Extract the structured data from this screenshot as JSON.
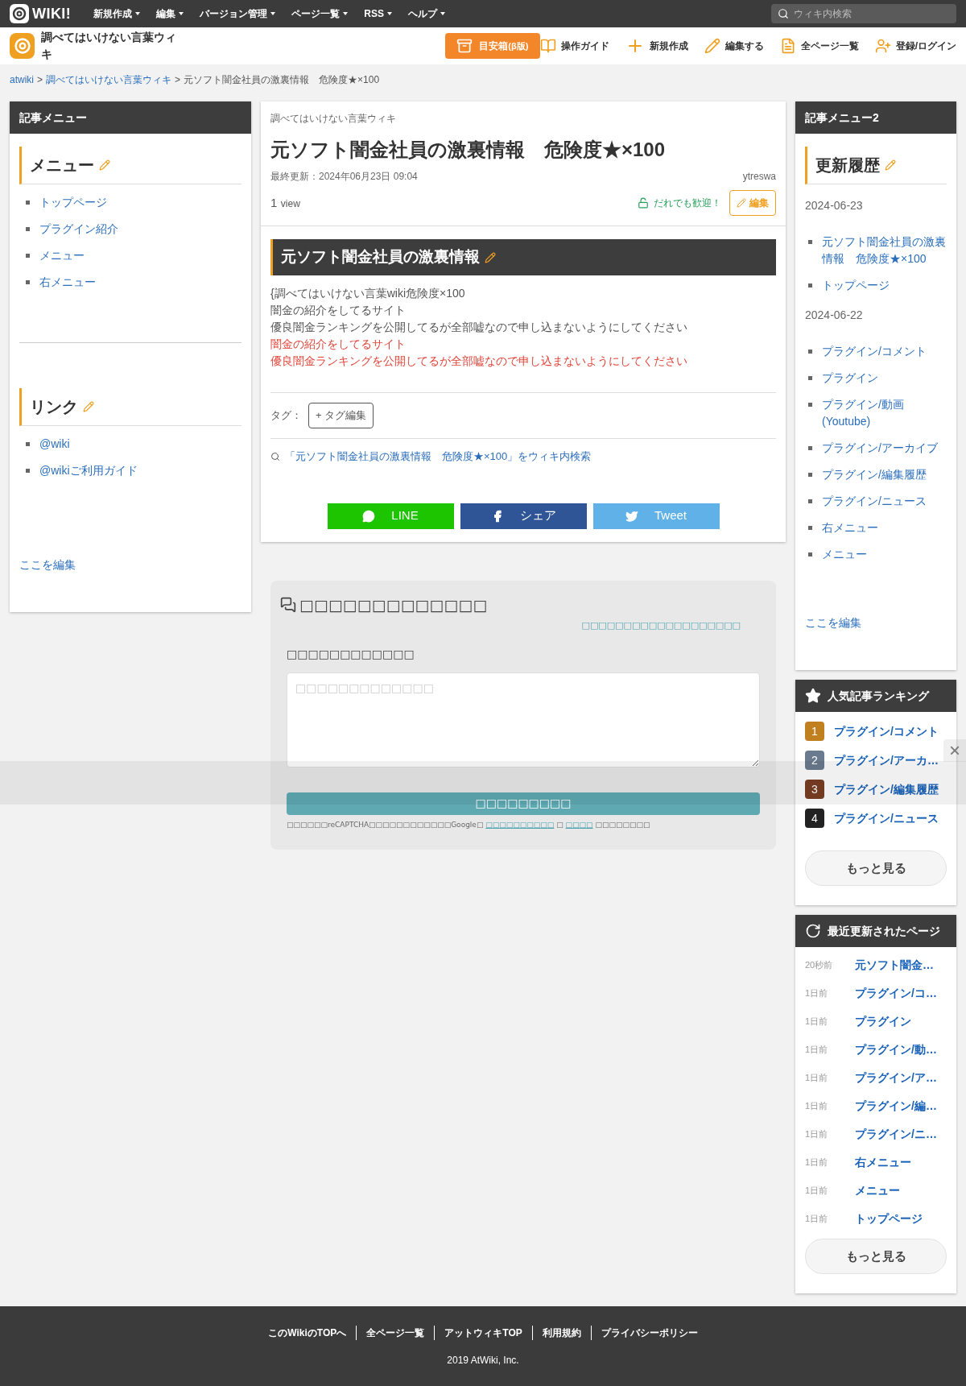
{
  "topbar": {
    "logo": "WIKI!",
    "menus": [
      {
        "label": "新規作成"
      },
      {
        "label": "編集"
      },
      {
        "label": "バージョン管理"
      },
      {
        "label": "ページ一覧"
      },
      {
        "label": "RSS"
      },
      {
        "label": "ヘルプ"
      }
    ],
    "search": {
      "placeholder": "ウィキ内検索"
    }
  },
  "subbar": {
    "site_title": "調べてはいけない言葉ウィキ",
    "box_button": {
      "label": "目安箱",
      "suffix": "(β版)"
    },
    "actions": [
      {
        "kind": "guide",
        "label": "操作ガイド"
      },
      {
        "kind": "new",
        "label": "新規作成"
      },
      {
        "kind": "edit",
        "label": "編集する"
      },
      {
        "kind": "list",
        "label": "全ページ一覧"
      },
      {
        "kind": "login",
        "label": "登録/ログイン"
      }
    ]
  },
  "breadcrumb": [
    {
      "label": "atwiki",
      "link": true
    },
    {
      "label": ">",
      "link": false
    },
    {
      "label": "調べてはいけない言葉ウィキ",
      "link": true
    },
    {
      "label": ">",
      "link": false
    },
    {
      "label": "元ソフト闇金社員の激裏情報　危険度★×100",
      "link": false
    }
  ],
  "left_sidebar": {
    "title": "記事メニュー",
    "sections": [
      {
        "heading": "メニュー",
        "items": [
          "トップページ",
          "プラグイン紹介",
          "メニュー",
          "右メニュー"
        ]
      },
      {
        "heading": "リンク",
        "items": [
          "@wiki",
          "@wikiご利用ガイド"
        ]
      }
    ],
    "edit_link": "ここを編集"
  },
  "article": {
    "site": "調べてはいけない言葉ウィキ",
    "title": "元ソフト闇金社員の激裏情報　危険度★×100",
    "updated": "最終更新：2024年06月23日 09:04",
    "author": "ytreswa",
    "views": "1",
    "views_unit": "view",
    "welcome": "だれでも歓迎！",
    "edit_button": "編集",
    "section_heading": "元ソフト闇金社員の激裏情報",
    "lines": [
      {
        "text": "{調べてはいけない言葉wiki危険度×100",
        "color": "#555555"
      },
      {
        "text": "闇金の紹介をしてるサイト",
        "color": "#555555"
      },
      {
        "text": "優良闇金ランキングを公開してるが全部嘘なので申し込まないようにしてください",
        "color": "#555555"
      },
      {
        "text": "闇金の紹介をしてるサイト",
        "color": "#e0453a"
      },
      {
        "text": "優良闇金ランキングを公開してるが全部嘘なので申し込まないようにしてください",
        "color": "#e0453a"
      }
    ],
    "tags_label": "タグ：",
    "tag_edit_button": "+ タグ編集",
    "search_link": "「元ソフト闇金社員の激裏情報　危険度★×100」をウィキ内検索",
    "share": [
      {
        "kind": "line",
        "label": "LINE"
      },
      {
        "kind": "facebook",
        "label": "シェア"
      },
      {
        "kind": "twitter",
        "label": "Tweet"
      }
    ]
  },
  "comment_box": {
    "heading": "□□□□□□□□□□□□□",
    "top_link": "□□□□□□□□□□□□□□□□□□□",
    "label": "□□□□□□□□□□□□",
    "placeholder": "□□□□□□□□□□□□□",
    "submit": "□□□□□□□□□",
    "notice_start": "□□□□□□reCAPTCHA□□□□□□□□□□□□Google□",
    "notice_link1": "□□□□□□□□□□",
    "notice_mid": "□",
    "notice_link2": "□□□□",
    "notice_end": "□□□□□□□□"
  },
  "right_sidebar": {
    "title": "記事メニュー2",
    "heading": "更新履歴",
    "groups": [
      {
        "date": "2024-06-23",
        "items": [
          "元ソフト闇金社員の激裏情報　危険度★×100",
          "トップページ"
        ]
      },
      {
        "date": "2024-06-22",
        "items": [
          "プラグイン/コメント",
          "プラグイン",
          "プラグイン/動画(Youtube)",
          "プラグイン/アーカイブ",
          "プラグイン/編集履歴",
          "プラグイン/ニュース",
          "右メニュー",
          "メニュー"
        ]
      }
    ],
    "edit_link": "ここを編集"
  },
  "ranking": {
    "title": "人気記事ランキング",
    "items": [
      {
        "rank": "1",
        "title": "プラグイン/コメント",
        "color": "#c0801f"
      },
      {
        "rank": "2",
        "title": "プラグイン/アーカ…",
        "color": "#6b7b8f"
      },
      {
        "rank": "3",
        "title": "プラグイン/編集履歴",
        "color": "#7a3e22"
      },
      {
        "rank": "4",
        "title": "プラグイン/ニュース",
        "color": "#222222"
      }
    ],
    "more_button": "もっと見る"
  },
  "recent": {
    "title": "最近更新されたページ",
    "items": [
      {
        "time": "20秒前",
        "title": "元ソフト闇金…"
      },
      {
        "time": "1日前",
        "title": "プラグイン/コ…"
      },
      {
        "time": "1日前",
        "title": "プラグイン"
      },
      {
        "time": "1日前",
        "title": "プラグイン/動…"
      },
      {
        "time": "1日前",
        "title": "プラグイン/ア…"
      },
      {
        "time": "1日前",
        "title": "プラグイン/編…"
      },
      {
        "time": "1日前",
        "title": "プラグイン/ニ…"
      },
      {
        "time": "1日前",
        "title": "右メニュー"
      },
      {
        "time": "1日前",
        "title": "メニュー"
      },
      {
        "time": "1日前",
        "title": "トップページ"
      }
    ],
    "more_button": "もっと見る"
  },
  "overlay_bar": {
    "close": "×"
  },
  "footer": {
    "links": [
      "このWikiのTOPへ",
      "全ページ一覧",
      "アットウィキTOP",
      "利用規約",
      "プライバシーポリシー"
    ],
    "copyright": "2019 AtWiki, Inc."
  }
}
